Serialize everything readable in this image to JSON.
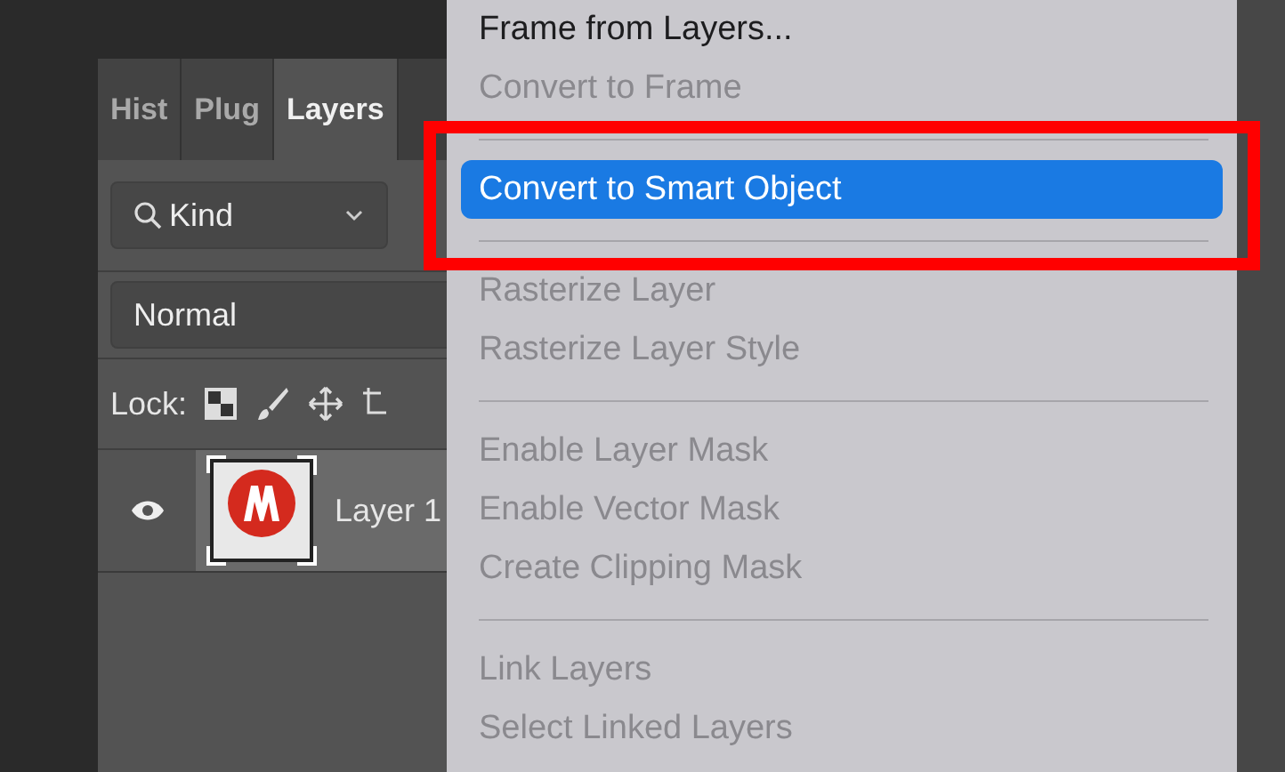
{
  "panel": {
    "tabs": [
      {
        "label": "Hist",
        "selected": false
      },
      {
        "label": "Plug",
        "selected": false
      },
      {
        "label": "Layers",
        "selected": true
      }
    ],
    "filter": {
      "value": "Kind"
    },
    "blend_mode": {
      "value": "Normal"
    },
    "lock": {
      "label": "Lock:"
    },
    "layers": [
      {
        "name": "Layer 1",
        "visible": true,
        "selected": true
      }
    ]
  },
  "context_menu": {
    "items": [
      {
        "kind": "item",
        "label": "Frame from Layers...",
        "disabled": false,
        "selected": false
      },
      {
        "kind": "item",
        "label": "Convert to Frame",
        "disabled": true,
        "selected": false
      },
      {
        "kind": "separator"
      },
      {
        "kind": "item",
        "label": "Convert to Smart Object",
        "disabled": false,
        "selected": true
      },
      {
        "kind": "separator"
      },
      {
        "kind": "item",
        "label": "Rasterize Layer",
        "disabled": true,
        "selected": false
      },
      {
        "kind": "item",
        "label": "Rasterize Layer Style",
        "disabled": true,
        "selected": false
      },
      {
        "kind": "separator"
      },
      {
        "kind": "item",
        "label": "Enable Layer Mask",
        "disabled": true,
        "selected": false
      },
      {
        "kind": "item",
        "label": "Enable Vector Mask",
        "disabled": true,
        "selected": false
      },
      {
        "kind": "item",
        "label": "Create Clipping Mask",
        "disabled": true,
        "selected": false
      },
      {
        "kind": "separator"
      },
      {
        "kind": "item",
        "label": "Link Layers",
        "disabled": true,
        "selected": false
      },
      {
        "kind": "item",
        "label": "Select Linked Layers",
        "disabled": true,
        "selected": false
      }
    ]
  }
}
